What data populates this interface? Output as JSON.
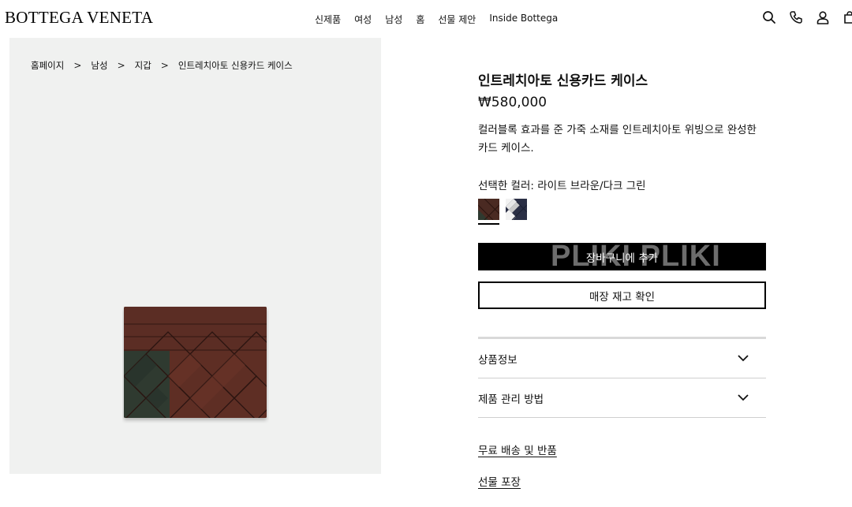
{
  "header": {
    "logo": "BOTTEGA VENETA",
    "nav": [
      "신제품",
      "여성",
      "남성",
      "홈",
      "선물 제안",
      "Inside Bottega"
    ],
    "icons": [
      "search-icon",
      "phone-icon",
      "account-icon",
      "shopping-bag-icon"
    ]
  },
  "breadcrumb": [
    "홈페이지",
    "남성",
    "지갑",
    "인트레치아토 신용카드 케이스"
  ],
  "breadcrumb_separator": ">",
  "product": {
    "name": "인트레치아토 신용카드 케이스",
    "price": "₩580,000",
    "description": "컬러블록 효과를 준 가죽 소재를 인트레치아토 위빙으로 완성한 카드 케이스.",
    "selected_color": "선택한 컬러: 라이트 브라운/다크 그린",
    "swatches": [
      {
        "name": "라이트 브라운/다크 그린",
        "selected": true,
        "colors": [
          "#4a2a22",
          "#2f3a30"
        ]
      },
      {
        "name": "네이비/화이트",
        "selected": false,
        "colors": [
          "#2a2f45",
          "#f2f2f2"
        ]
      }
    ]
  },
  "buttons": {
    "add_to_cart": "장바구니에 추가",
    "check_stock": "매장 재고 확인"
  },
  "watermark": "PLIKI PLIKI",
  "accordion": [
    "상품정보",
    "제품 관리 방법"
  ],
  "links": [
    "무료 배송 및 반품",
    "선물 포장"
  ],
  "colors": {
    "image_background": "#f0f1f0",
    "wallet_brown": "#5a2c22",
    "wallet_green": "#2f3a30",
    "button_black": "#000000"
  }
}
